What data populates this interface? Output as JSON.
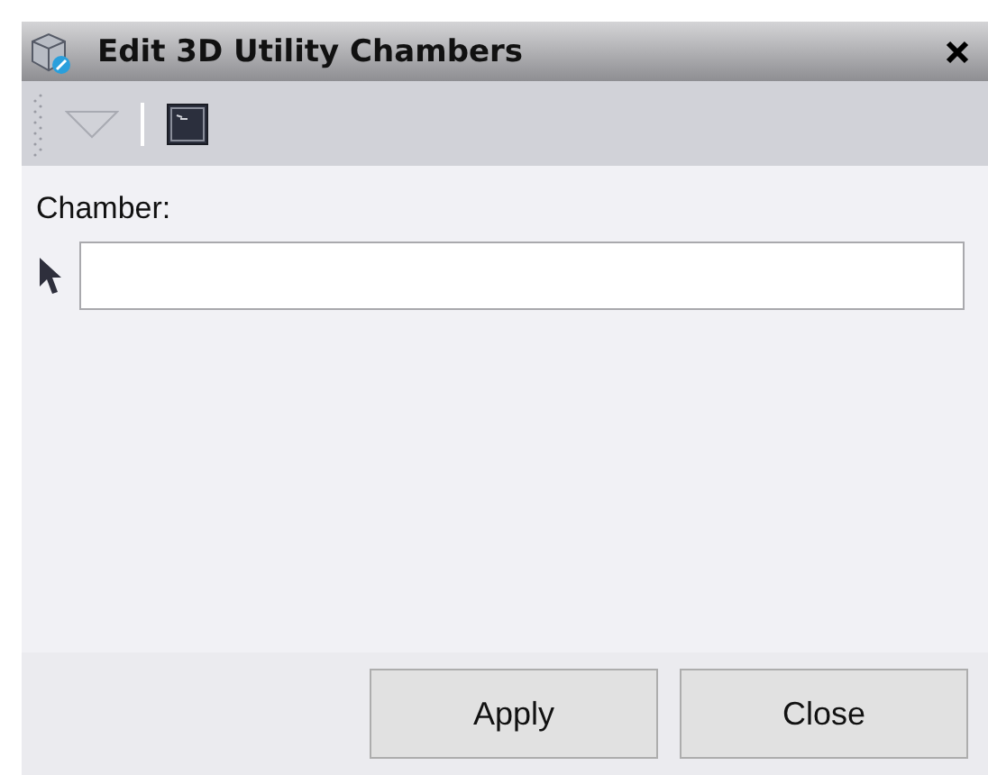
{
  "window": {
    "title": "Edit 3D Utility Chambers"
  },
  "field": {
    "label": "Chamber:"
  },
  "buttons": [
    "Apply",
    "Close"
  ]
}
